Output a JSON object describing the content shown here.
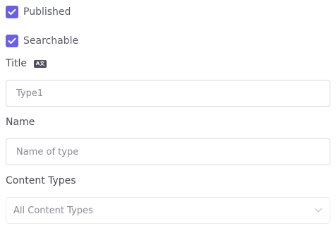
{
  "options": {
    "published": {
      "label": "Published",
      "checked": true
    },
    "searchable": {
      "label": "Searchable",
      "checked": true
    }
  },
  "fields": {
    "title": {
      "label": "Title",
      "badge": "A文",
      "value": "Type1"
    },
    "name": {
      "label": "Name",
      "placeholder": "Name of type"
    },
    "content_types": {
      "label": "Content Types",
      "selected": "All Content Types"
    }
  },
  "colors": {
    "accent": "#6b5fe3",
    "border": "#d9d9e0"
  },
  "icons": {
    "checkbox_mark": "check-icon",
    "title_badge": "translate-icon",
    "select_arrow": "chevron-down-icon"
  }
}
